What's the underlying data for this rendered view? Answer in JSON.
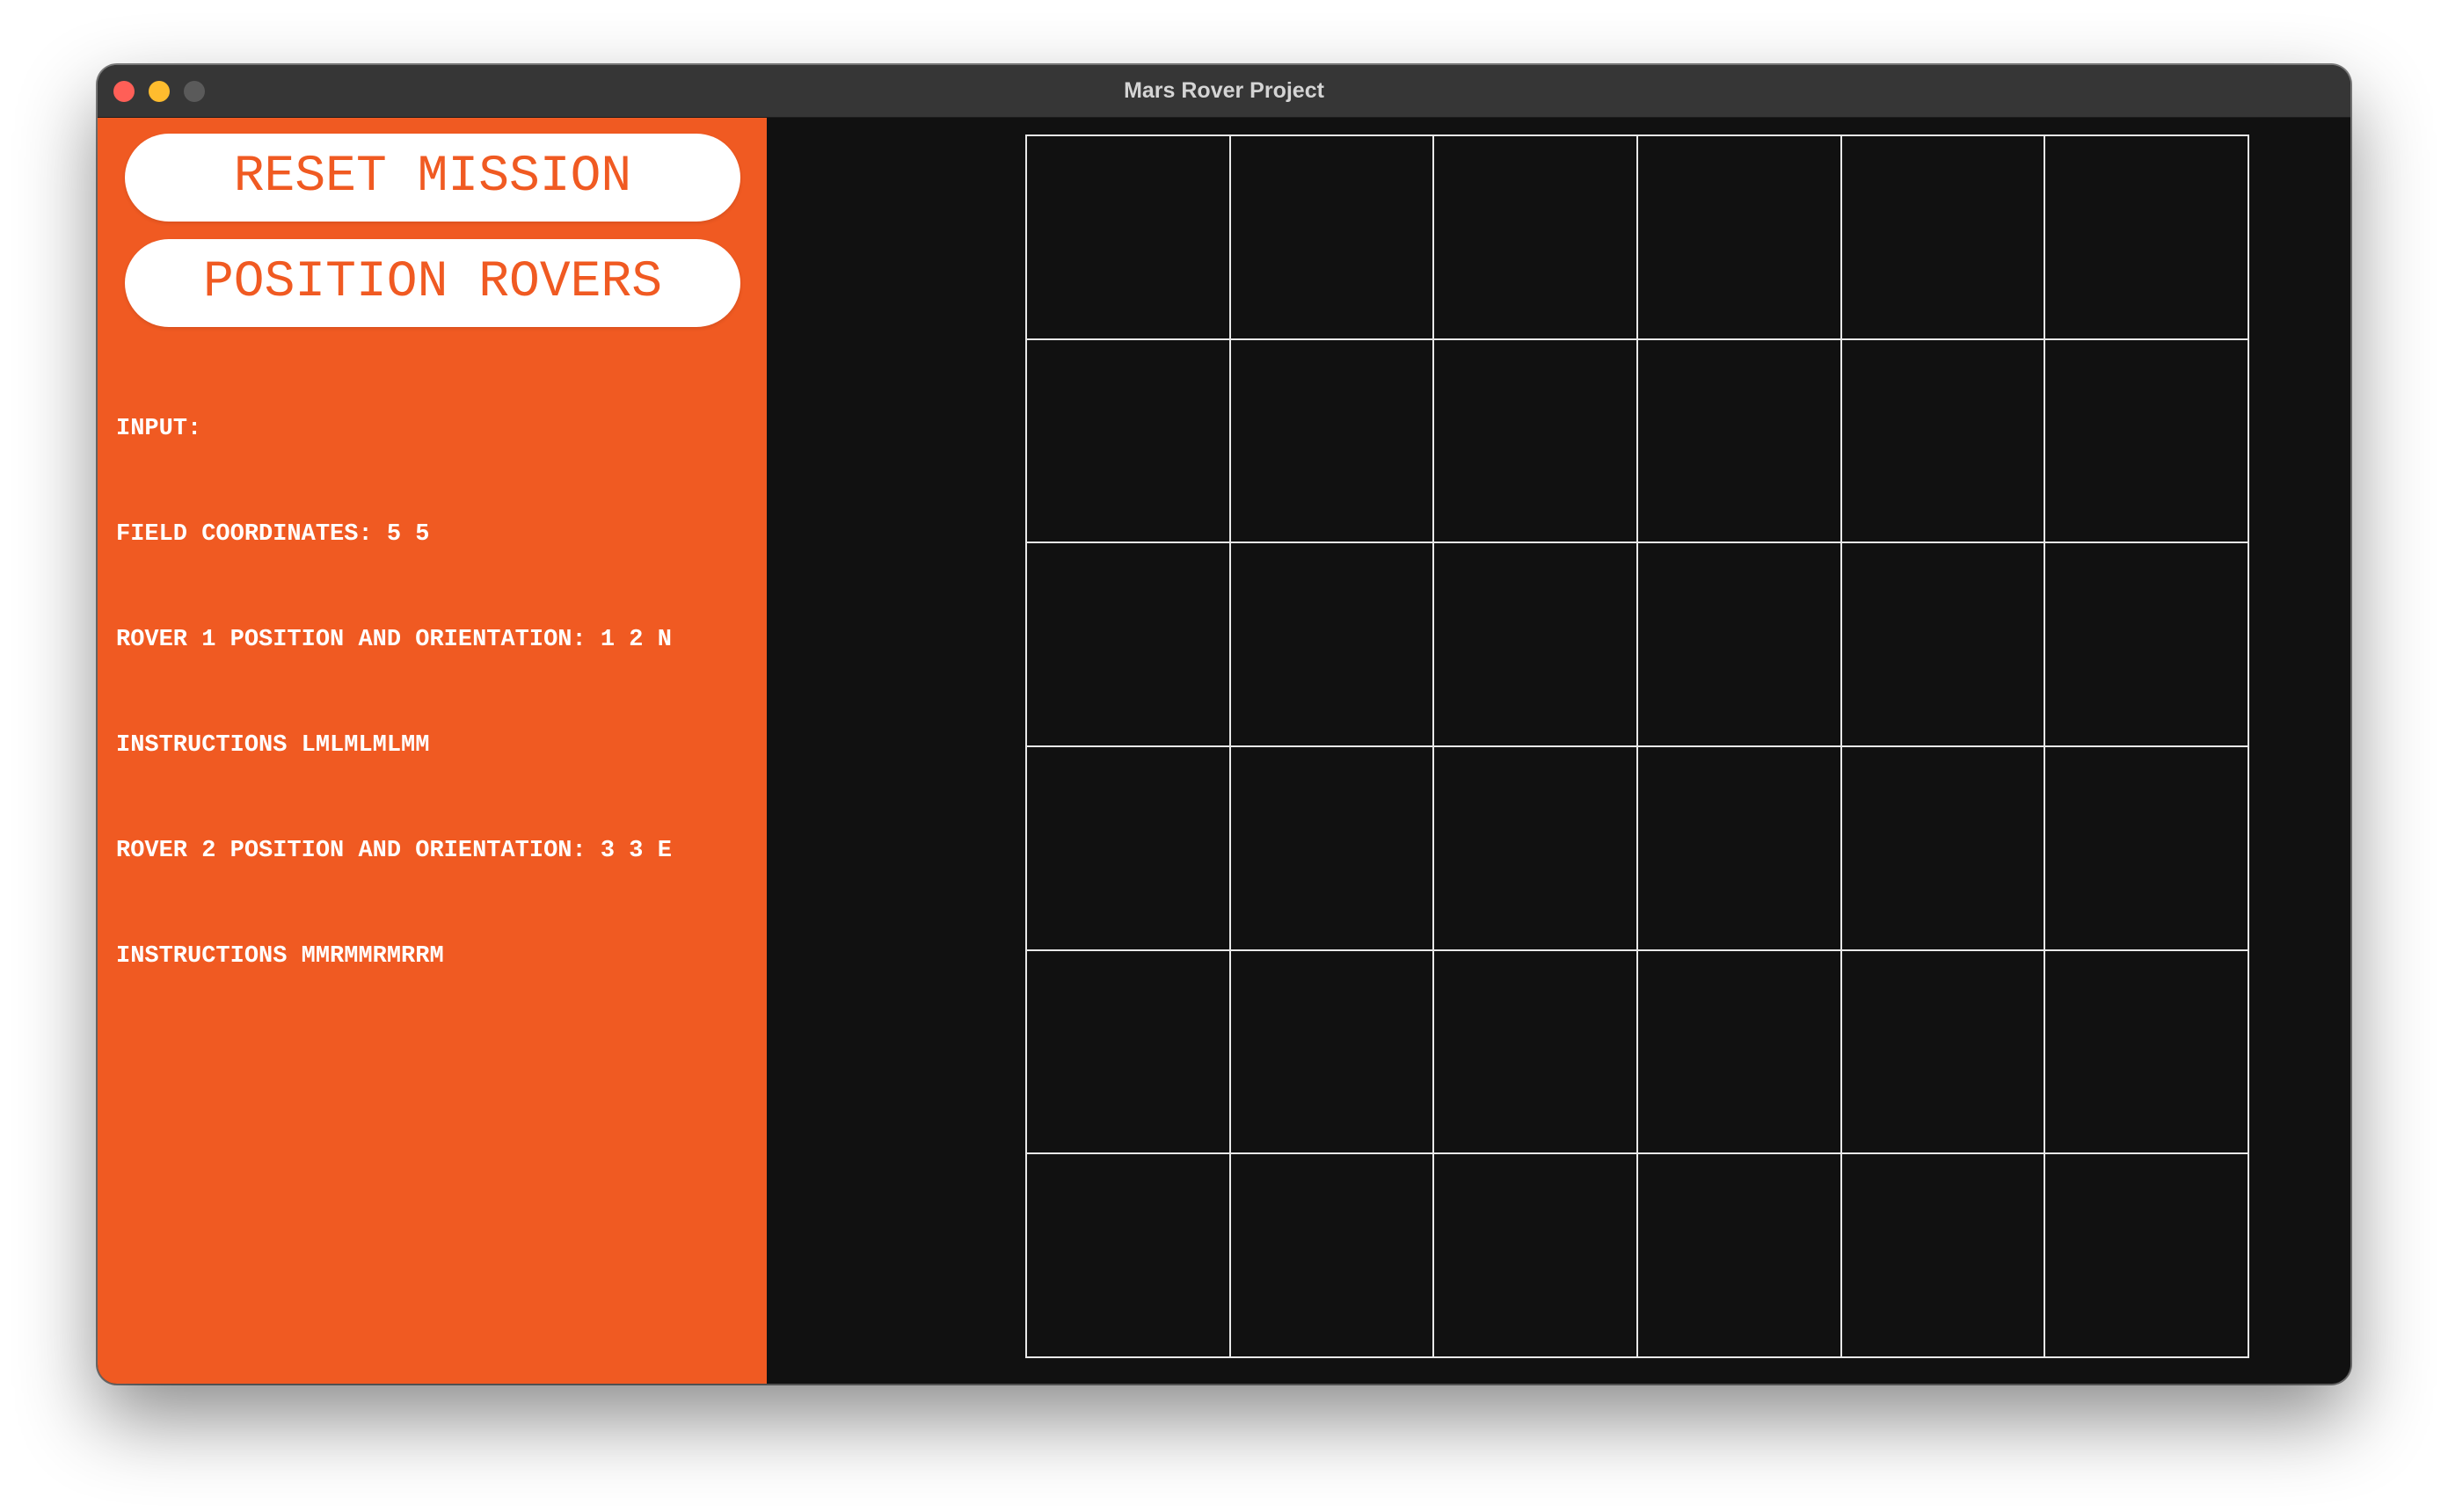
{
  "window": {
    "title": "Mars Rover Project"
  },
  "sidebar": {
    "reset_label": "RESET MISSION",
    "position_label": "POSITION ROVERS",
    "info_lines": [
      "INPUT:",
      "FIELD COORDINATES: 5 5",
      "ROVER 1 POSITION AND ORIENTATION: 1 2 N",
      "INSTRUCTIONS LMLMLMLMM",
      "ROVER 2 POSITION AND ORIENTATION: 3 3 E",
      "INSTRUCTIONS MMRMMRMRRM"
    ]
  },
  "colors": {
    "accent": "#f05a22",
    "panel_bg": "#111111",
    "grid_line": "#e8e8e8",
    "button_bg": "#ffffff"
  },
  "grid": {
    "columns": 6,
    "rows": 6
  }
}
